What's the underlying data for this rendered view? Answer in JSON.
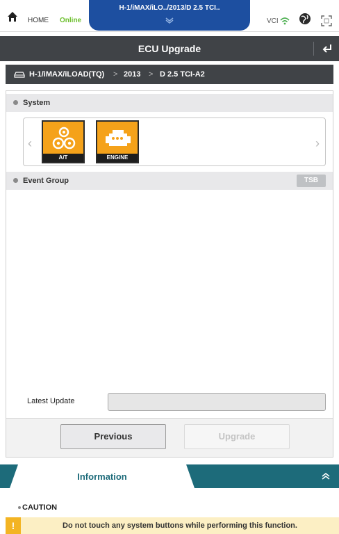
{
  "topbar": {
    "home_label": "HOME",
    "status": "Online",
    "vehicle_path": "H-1/iMAX/iLO../2013/D 2.5 TCI..",
    "vci_label": "VCI",
    "colors": {
      "online": "#6cbf2c",
      "path_tab": "#1d4fa0"
    }
  },
  "titlebar": {
    "title": "ECU Upgrade"
  },
  "breadcrumb": {
    "items": [
      "H-1/iMAX/iLOAD(TQ)",
      "2013",
      "D 2.5 TCI-A2"
    ],
    "separator": ">"
  },
  "system_section": {
    "label": "System",
    "tiles": [
      {
        "label": "A/T",
        "icon": "gears-icon"
      },
      {
        "label": "ENGINE",
        "icon": "engine-icon"
      }
    ],
    "tile_color": "#f5a21a"
  },
  "event_section": {
    "label": "Event Group",
    "tsb_label": "TSB"
  },
  "latest_update": {
    "label": "Latest Update",
    "value": ""
  },
  "buttons": {
    "previous": "Previous",
    "upgrade": "Upgrade"
  },
  "info": {
    "tab_label": "Information",
    "caution_label": "CAUTION",
    "caution_text": "Do not touch any system buttons while performing this function.",
    "colors": {
      "bar": "#1d6b7a",
      "warn": "#f3b423"
    }
  }
}
